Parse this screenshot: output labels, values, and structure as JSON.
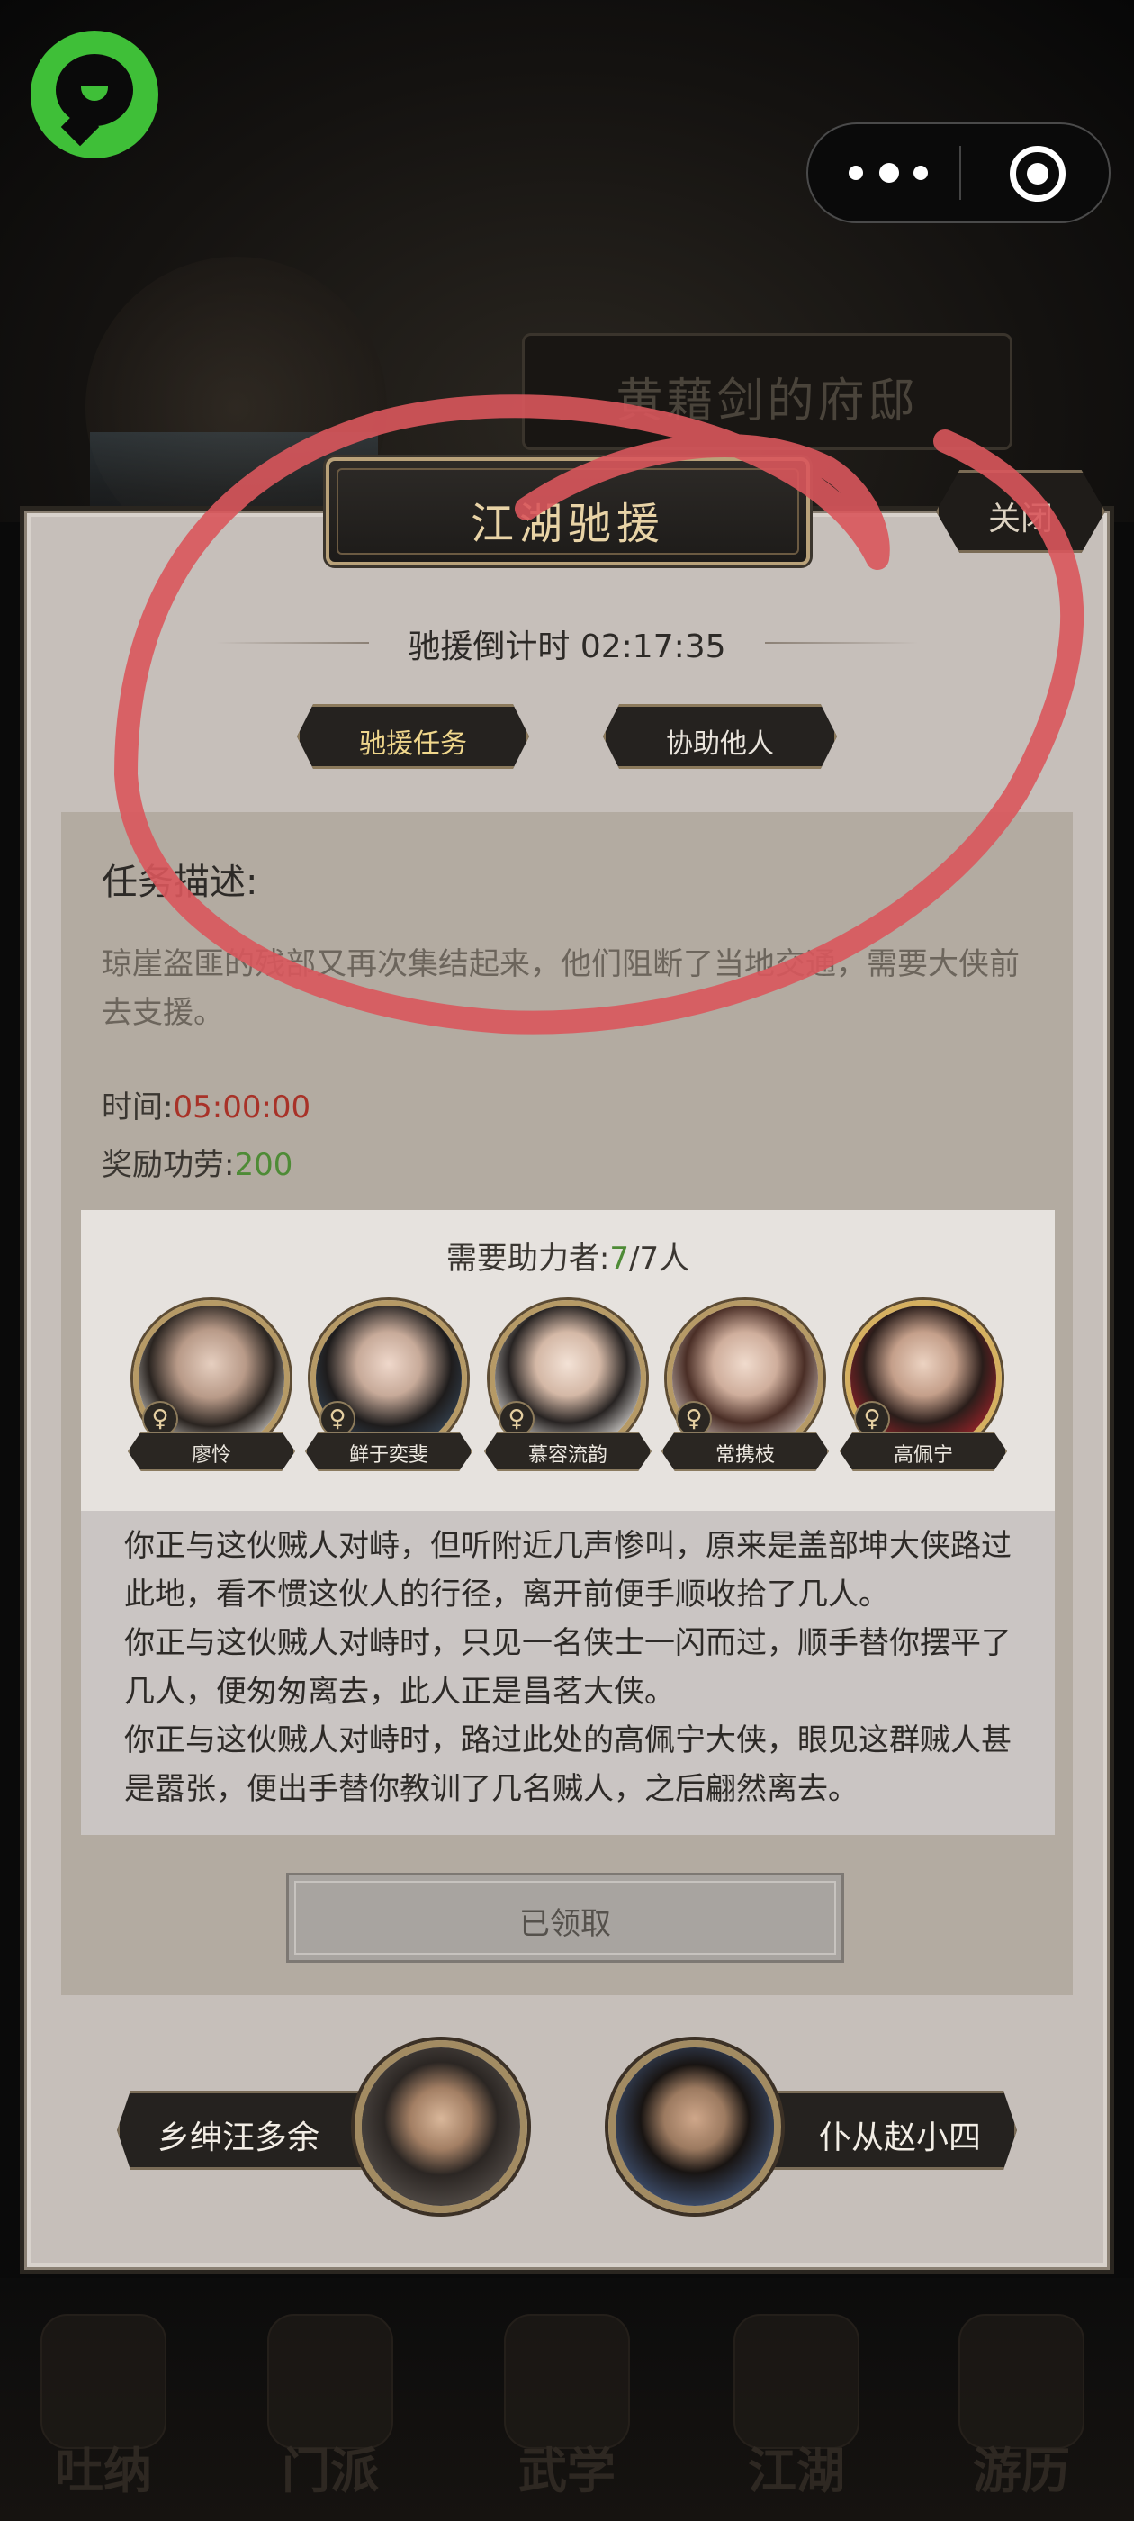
{
  "background": {
    "mansion_title": "黄藉剑的府邸"
  },
  "wechat": {
    "logo_icon": "wechat-mini-program-icon",
    "menu_icon": "more-dots-icon",
    "close_icon": "target-close-icon"
  },
  "dialog": {
    "title": "江湖驰援",
    "close_label": "关闭",
    "countdown": "驰援倒计时 02:17:35",
    "tabs": [
      {
        "label": "驰援任务",
        "active": true
      },
      {
        "label": "协助他人",
        "active": false
      }
    ],
    "task": {
      "heading": "任务描述:",
      "description": "琼崖盗匪的残部又再次集结起来，他们阻断了当地交通，需要大侠前去支援。",
      "time_label": "时间:",
      "time_value": "05:00:00",
      "reward_label": "奖励功劳:",
      "reward_value": "200"
    },
    "helpers": {
      "title_prefix": "需要助力者:",
      "count_current": "7",
      "count_total": "/7人",
      "list": [
        {
          "name": "廖怜",
          "gender": "♀"
        },
        {
          "name": "鲜于奕斐",
          "gender": "♀"
        },
        {
          "name": "慕容流韵",
          "gender": "♀"
        },
        {
          "name": "常携枝",
          "gender": "♀"
        },
        {
          "name": "高佩宁",
          "gender": "♀"
        }
      ]
    },
    "story": [
      "你正与这伙贼人对峙，但听附近几声惨叫，原来是盖部坤大侠路过此地，看不惯这伙人的行径，离开前便手顺收拾了几人。",
      "你正与这伙贼人对峙时，只见一名侠士一闪而过，顺手替你摆平了几人，便匆匆离去，此人正是昌茗大侠。",
      "你正与这伙贼人对峙时，路过此处的高佩宁大侠，眼见这群贼人甚是嚣张，便出手替你教训了几名贼人，之后翩然离去。"
    ],
    "claimed_label": "已领取",
    "npcs": [
      {
        "label": "乡绅汪多余"
      },
      {
        "label": "仆从赵小四"
      }
    ]
  },
  "bottom_nav": [
    {
      "label": "吐纳"
    },
    {
      "label": "门派"
    },
    {
      "label": "武学"
    },
    {
      "label": "江湖"
    },
    {
      "label": "游历"
    }
  ],
  "colors": {
    "annotation": "#d9575c",
    "accent_gold": "#e8d3a6",
    "time_red": "#a83228",
    "reward_green": "#4e8b36"
  }
}
